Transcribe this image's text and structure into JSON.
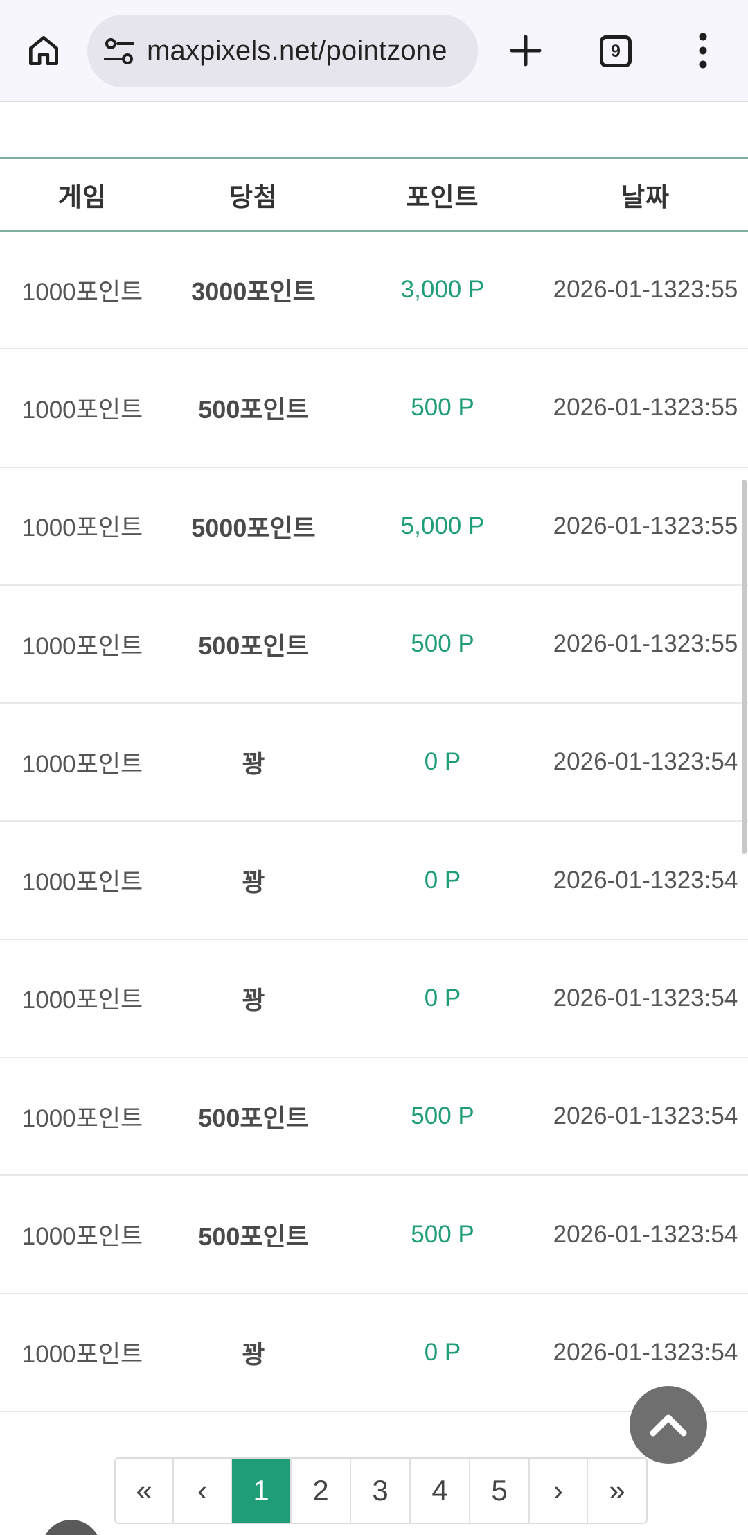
{
  "browser": {
    "url": "maxpixels.net/pointzone",
    "tab_count": "9",
    "icons": [
      "home-icon",
      "site-settings-icon",
      "new-tab-icon",
      "tab-switcher-icon",
      "more-vert-icon"
    ]
  },
  "table": {
    "headers": [
      "게임",
      "당첨",
      "포인트",
      "날짜"
    ],
    "rows": [
      {
        "game": "1000포인트",
        "win": "3000포인트",
        "point": "3,000 P",
        "date": "2026-01-13",
        "time": "23:55"
      },
      {
        "game": "1000포인트",
        "win": "500포인트",
        "point": "500 P",
        "date": "2026-01-13",
        "time": "23:55"
      },
      {
        "game": "1000포인트",
        "win": "5000포인트",
        "point": "5,000 P",
        "date": "2026-01-13",
        "time": "23:55"
      },
      {
        "game": "1000포인트",
        "win": "500포인트",
        "point": "500 P",
        "date": "2026-01-13",
        "time": "23:55"
      },
      {
        "game": "1000포인트",
        "win": "꽝",
        "point": "0 P",
        "date": "2026-01-13",
        "time": "23:54"
      },
      {
        "game": "1000포인트",
        "win": "꽝",
        "point": "0 P",
        "date": "2026-01-13",
        "time": "23:54"
      },
      {
        "game": "1000포인트",
        "win": "꽝",
        "point": "0 P",
        "date": "2026-01-13",
        "time": "23:54"
      },
      {
        "game": "1000포인트",
        "win": "500포인트",
        "point": "500 P",
        "date": "2026-01-13",
        "time": "23:54"
      },
      {
        "game": "1000포인트",
        "win": "500포인트",
        "point": "500 P",
        "date": "2026-01-13",
        "time": "23:54"
      },
      {
        "game": "1000포인트",
        "win": "꽝",
        "point": "0 P",
        "date": "2026-01-13",
        "time": "23:54"
      }
    ]
  },
  "pagination": {
    "first": "«",
    "prev": "‹",
    "pages": [
      "1",
      "2",
      "3",
      "4",
      "5"
    ],
    "current": "1",
    "next": "›",
    "last": "»"
  },
  "colors": {
    "accent": "#1f9d78",
    "header_rule": "#7fae9a"
  }
}
